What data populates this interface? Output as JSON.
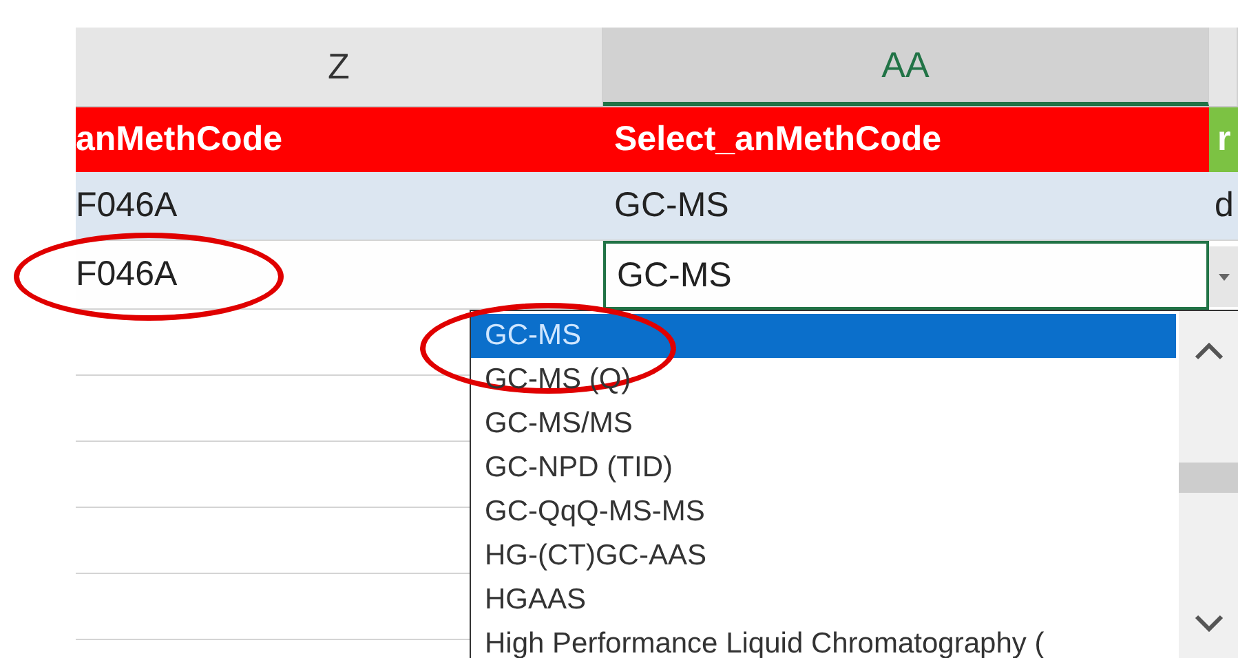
{
  "column_headers": [
    {
      "label": "Z",
      "selected": false
    },
    {
      "label": "AA",
      "selected": true
    },
    {
      "selected": false
    }
  ],
  "header_row": [
    {
      "text": "anMethCode",
      "color": "#ff0000"
    },
    {
      "text": "Select_anMethCode",
      "color": "#ff0000"
    },
    {
      "text": "r",
      "color": "#7cc243"
    }
  ],
  "rows": [
    {
      "cells": [
        "F046A",
        "GC-MS",
        "d"
      ],
      "circled": false,
      "banded": true
    },
    {
      "cells": [
        "F046A",
        "GC-MS"
      ],
      "circled": true,
      "banded": false
    }
  ],
  "dropdown": {
    "items": [
      {
        "label": "GC-MS",
        "selected": true,
        "circled": true
      },
      {
        "label": "GC-MS (Q)",
        "selected": false,
        "circled": false
      },
      {
        "label": "GC-MS/MS",
        "selected": false,
        "circled": false
      },
      {
        "label": "GC-NPD (TID)",
        "selected": false,
        "circled": false
      },
      {
        "label": "GC-QqQ-MS-MS",
        "selected": false,
        "circled": false
      },
      {
        "label": "HG-(CT)GC-AAS",
        "selected": false,
        "circled": false
      },
      {
        "label": "HGAAS",
        "selected": false,
        "circled": false
      },
      {
        "label": "High Performance Liquid Chromatography (",
        "selected": false,
        "circled": false
      }
    ]
  }
}
